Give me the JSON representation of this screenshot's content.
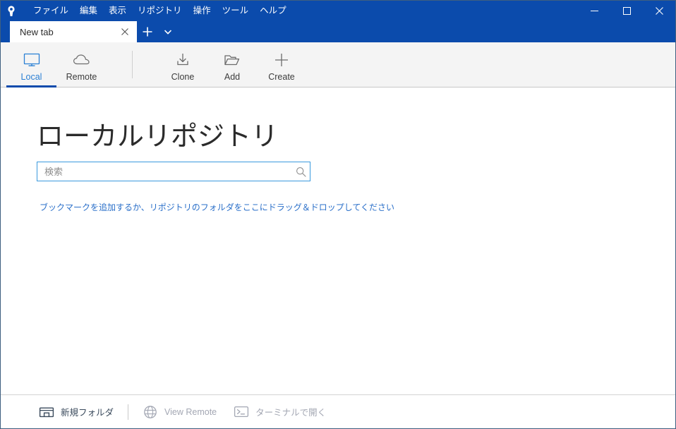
{
  "window": {
    "logo_icon": "sourcetree-logo-icon",
    "controls": {
      "minimize": "minimize-icon",
      "maximize": "maximize-icon",
      "close": "close-icon"
    }
  },
  "menu": {
    "items": [
      {
        "label": "ファイル",
        "name": "menu-file"
      },
      {
        "label": "編集",
        "name": "menu-edit"
      },
      {
        "label": "表示",
        "name": "menu-view"
      },
      {
        "label": "リポジトリ",
        "name": "menu-repository"
      },
      {
        "label": "操作",
        "name": "menu-actions"
      },
      {
        "label": "ツール",
        "name": "menu-tools"
      },
      {
        "label": "ヘルプ",
        "name": "menu-help"
      }
    ]
  },
  "tabs": {
    "active_tab_label": "New tab",
    "close_glyph": "✕",
    "new_tab_glyph": "+",
    "tab_list_glyph": "▾"
  },
  "toolbar": {
    "groups": [
      {
        "buttons": [
          {
            "label": "Local",
            "icon": "monitor-icon",
            "active": true
          },
          {
            "label": "Remote",
            "icon": "cloud-icon",
            "active": false
          }
        ]
      },
      {
        "buttons": [
          {
            "label": "Clone",
            "icon": "clone-download-icon",
            "active": false
          },
          {
            "label": "Add",
            "icon": "folder-open-icon",
            "active": false
          },
          {
            "label": "Create",
            "icon": "plus-icon",
            "active": false
          }
        ]
      }
    ]
  },
  "main": {
    "title": "ローカルリポジトリ",
    "search": {
      "value": "",
      "placeholder": "検索",
      "icon": "search-icon"
    },
    "drop_hint": "ブックマークを追加するか、リポジトリのフォルダをここにドラッグ＆ドロップしてください"
  },
  "footer": {
    "buttons": [
      {
        "label": "新規フォルダ",
        "icon": "new-folder-icon",
        "enabled": true
      },
      {
        "label": "View Remote",
        "icon": "globe-icon",
        "enabled": false
      },
      {
        "label": "ターミナルで開く",
        "icon": "terminal-icon",
        "enabled": false
      }
    ]
  },
  "colors": {
    "title_bar_blue": "#0b4bac",
    "accent_blue": "#2a7fd4",
    "link_blue": "#2a6fc9",
    "toolbar_bg": "#f4f4f4",
    "disabled_gray": "#a3a7b3"
  }
}
